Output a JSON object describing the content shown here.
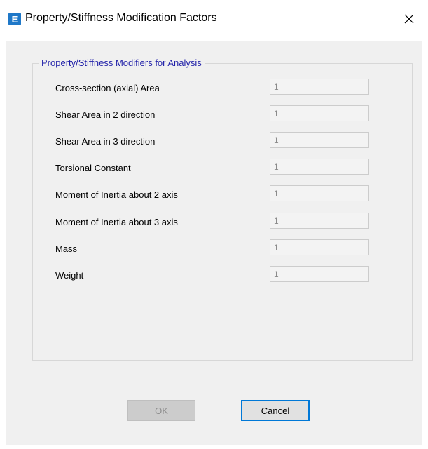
{
  "window": {
    "title": "Property/Stiffness Modification Factors",
    "app_icon_letter": "E",
    "app_icon": "etabs-logo-icon",
    "close_icon": "close-icon",
    "accent": "#1f78c8"
  },
  "group": {
    "title": "Property/Stiffness Modifiers for Analysis",
    "title_color": "#1f1fa8"
  },
  "rows": [
    {
      "label": "Cross-section (axial) Area",
      "value": "1"
    },
    {
      "label": "Shear Area in 2 direction",
      "value": "1"
    },
    {
      "label": "Shear Area in 3 direction",
      "value": "1"
    },
    {
      "label": "Torsional Constant",
      "value": "1"
    },
    {
      "label": "Moment of Inertia about 2 axis",
      "value": "1"
    },
    {
      "label": "Moment of Inertia about 3 axis",
      "value": "1"
    },
    {
      "label": "Mass",
      "value": "1"
    },
    {
      "label": "Weight",
      "value": "1"
    }
  ],
  "buttons": {
    "ok_label": "OK",
    "cancel_label": "Cancel"
  }
}
